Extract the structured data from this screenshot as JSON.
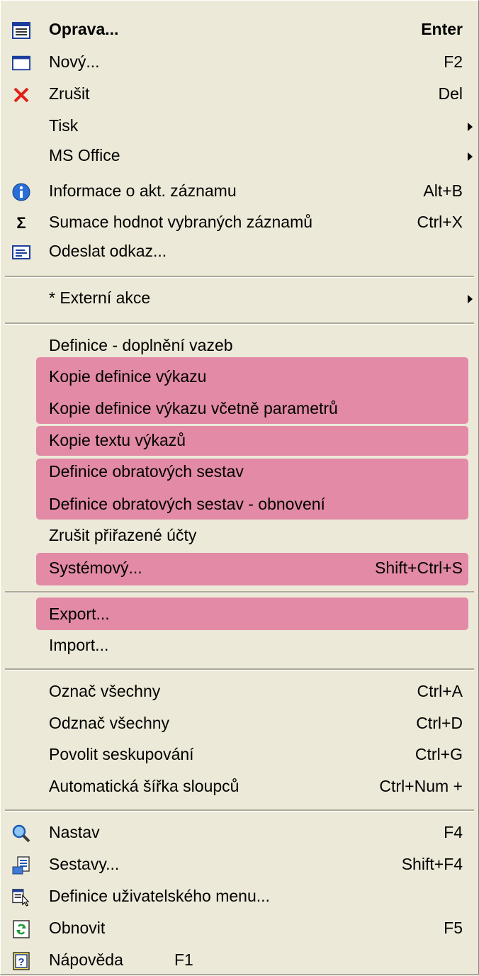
{
  "menu": {
    "items": [
      {
        "label": "Oprava...",
        "shortcut": "Enter",
        "icon": "edit-form-icon"
      },
      {
        "label": "Nový...",
        "shortcut": "F2",
        "icon": "new-window-icon"
      },
      {
        "label": "Zrušit",
        "shortcut": "Del",
        "icon": "delete-x-icon"
      },
      {
        "label": "Tisk",
        "shortcut": ""
      },
      {
        "label": "MS Office",
        "shortcut": ""
      },
      {
        "label": "Informace o akt. záznamu",
        "shortcut": "Alt+B",
        "icon": "info-icon"
      },
      {
        "label": "Sumace hodnot vybraných záznamů",
        "shortcut": "Ctrl+X",
        "icon": "sigma-icon"
      },
      {
        "label": "Odeslat odkaz...",
        "shortcut": "",
        "icon": "send-link-icon"
      },
      {
        "label": "* Externí akce",
        "shortcut": ""
      },
      {
        "label": "Definice - doplnění vazeb",
        "shortcut": ""
      },
      {
        "label": "Kopie definice výkazu",
        "shortcut": ""
      },
      {
        "label": "Kopie definice výkazu včetně parametrů",
        "shortcut": ""
      },
      {
        "label": "Kopie textu výkazů",
        "shortcut": ""
      },
      {
        "label": "Definice obratových sestav",
        "shortcut": ""
      },
      {
        "label": "Definice obratových sestav - obnovení",
        "shortcut": ""
      },
      {
        "label": "Zrušit přiřazené účty",
        "shortcut": ""
      },
      {
        "label": "Systémový...",
        "shortcut": "Shift+Ctrl+S"
      },
      {
        "label": "Export...",
        "shortcut": ""
      },
      {
        "label": "Import...",
        "shortcut": ""
      },
      {
        "label": "Označ všechny",
        "shortcut": "Ctrl+A"
      },
      {
        "label": "Odznač všechny",
        "shortcut": "Ctrl+D"
      },
      {
        "label": "Povolit seskupování",
        "shortcut": "Ctrl+G"
      },
      {
        "label": "Automatická šířka sloupců",
        "shortcut": "Ctrl+Num +"
      },
      {
        "label": "Nastav",
        "shortcut": "F4",
        "icon": "magnifier-icon"
      },
      {
        "label": "Sestavy...",
        "shortcut": "Shift+F4",
        "icon": "report-icon"
      },
      {
        "label": "Definice uživatelského menu...",
        "shortcut": "",
        "icon": "menu-definition-icon"
      },
      {
        "label": "Obnovit",
        "shortcut": "F5",
        "icon": "refresh-icon"
      },
      {
        "label": "Nápověda",
        "shortcut": "F1",
        "icon": "help-icon"
      }
    ]
  },
  "colors": {
    "highlight": "#e28aa6",
    "background": "#ece9d8"
  }
}
